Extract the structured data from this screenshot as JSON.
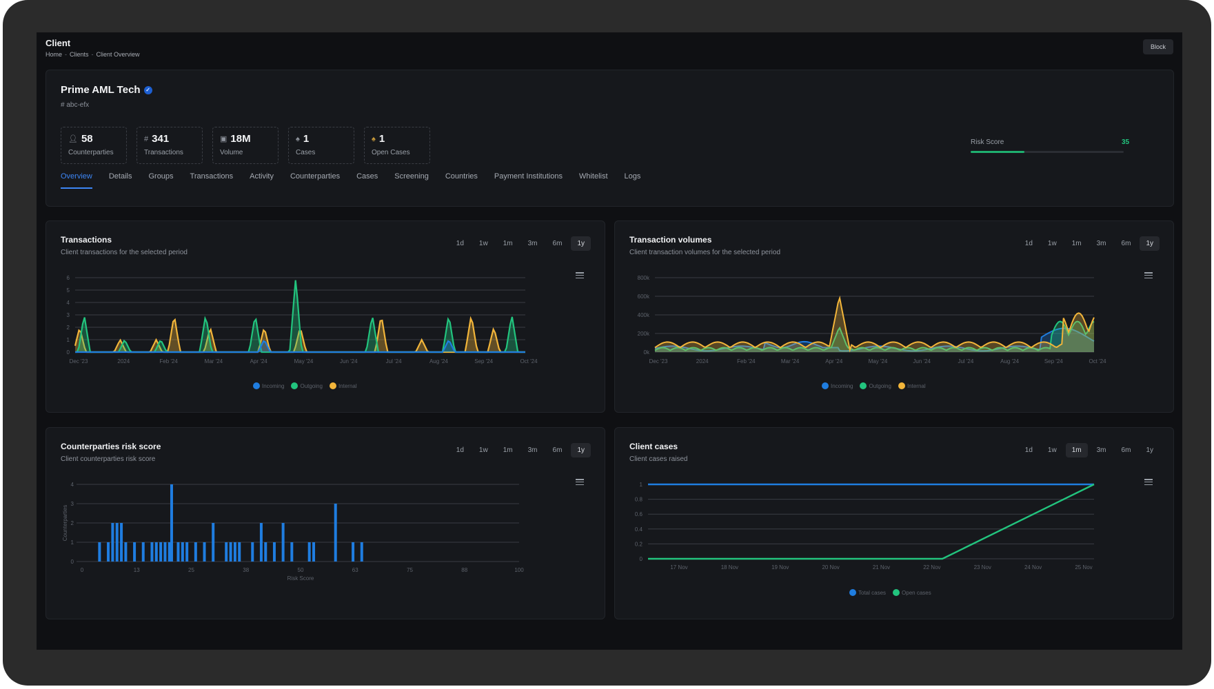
{
  "header": {
    "title": "Client",
    "breadcrumb": [
      "Home",
      "Clients",
      "Client Overview"
    ],
    "block_label": "Block"
  },
  "client": {
    "name": "Prime AML Tech",
    "id": "# abc-efx"
  },
  "stats": [
    {
      "icon": "user-icon",
      "value": "58",
      "label": "Counterparties"
    },
    {
      "icon": "hash-icon",
      "value": "341",
      "label": "Transactions"
    },
    {
      "icon": "money-icon",
      "value": "18M",
      "label": "Volume"
    },
    {
      "icon": "flame-icon",
      "value": "1",
      "label": "Cases"
    },
    {
      "icon": "flame-icon",
      "value": "1",
      "label": "Open Cases"
    }
  ],
  "risk": {
    "label": "Risk Score",
    "value": "35",
    "fraction": 0.35
  },
  "tabs": [
    "Overview",
    "Details",
    "Groups",
    "Transactions",
    "Activity",
    "Counterparties",
    "Cases",
    "Screening",
    "Countries",
    "Payment Institutions",
    "Whitelist",
    "Logs"
  ],
  "ranges": [
    "1d",
    "1w",
    "1m",
    "3m",
    "6m",
    "1y"
  ],
  "colors": {
    "incoming": "#1f7de0",
    "outgoing": "#22c47e",
    "internal": "#f2b53a",
    "accent": "#3d86f5"
  },
  "chart_data": [
    {
      "type": "area",
      "title": "Transactions",
      "subtitle": "Client transactions for the selected period",
      "active_range": "1y",
      "x": [
        "Dec '23",
        "2024",
        "Feb '24",
        "Mar '24",
        "Apr '24",
        "May '24",
        "Jun '24",
        "Jul '24",
        "Aug '24",
        "Sep '24",
        "Oct '24"
      ],
      "ylim": [
        0,
        6
      ],
      "yticks": [
        "0",
        "1",
        "2",
        "3",
        "4",
        "5",
        "6"
      ],
      "series": [
        {
          "name": "Incoming",
          "peaks": [
            {
              "x": 0.42,
              "y": 1
            },
            {
              "x": 0.83,
              "y": 1
            }
          ]
        },
        {
          "name": "Outgoing",
          "peaks": [
            {
              "x": 0.02,
              "y": 3
            },
            {
              "x": 0.11,
              "y": 1
            },
            {
              "x": 0.19,
              "y": 1
            },
            {
              "x": 0.29,
              "y": 3
            },
            {
              "x": 0.4,
              "y": 3
            },
            {
              "x": 0.49,
              "y": 6
            },
            {
              "x": 0.66,
              "y": 3
            },
            {
              "x": 0.83,
              "y": 3
            },
            {
              "x": 0.97,
              "y": 3
            }
          ]
        },
        {
          "name": "Internal",
          "peaks": [
            {
              "x": 0.01,
              "y": 2
            },
            {
              "x": 0.1,
              "y": 1
            },
            {
              "x": 0.18,
              "y": 1
            },
            {
              "x": 0.22,
              "y": 3
            },
            {
              "x": 0.3,
              "y": 2
            },
            {
              "x": 0.42,
              "y": 2
            },
            {
              "x": 0.5,
              "y": 2
            },
            {
              "x": 0.68,
              "y": 3
            },
            {
              "x": 0.77,
              "y": 1
            },
            {
              "x": 0.88,
              "y": 3
            },
            {
              "x": 0.93,
              "y": 2
            }
          ]
        }
      ],
      "legend": [
        "Incoming",
        "Outgoing",
        "Internal"
      ]
    },
    {
      "type": "area",
      "title": "Transaction volumes",
      "subtitle": "Client transaction volumes for the selected period",
      "active_range": "1y",
      "x": [
        "Dec '23",
        "2024",
        "Feb '24",
        "Mar '24",
        "Apr '24",
        "May '24",
        "Jun '24",
        "Jul '24",
        "Aug '24",
        "Sep '24",
        "Oct '24"
      ],
      "ylim": [
        0,
        800000
      ],
      "yticks": [
        "0k",
        "200k",
        "400k",
        "600k",
        "800k"
      ],
      "legend": [
        "Incoming",
        "Outgoing",
        "Internal"
      ]
    },
    {
      "type": "bar",
      "title": "Counterparties risk score",
      "subtitle": "Client counterparties risk score",
      "active_range": "1y",
      "xlabel": "Risk Score",
      "ylabel": "Counterparties",
      "xticks": [
        "0",
        "13",
        "25",
        "38",
        "50",
        "63",
        "75",
        "88",
        "100"
      ],
      "yticks": [
        "0",
        "1",
        "2",
        "3",
        "4"
      ],
      "ylim": [
        0,
        4
      ],
      "xlim": [
        0,
        100
      ],
      "points": [
        [
          4,
          1
        ],
        [
          6,
          1
        ],
        [
          7,
          2
        ],
        [
          8,
          2
        ],
        [
          9,
          2
        ],
        [
          10,
          1
        ],
        [
          12,
          1
        ],
        [
          14,
          1
        ],
        [
          16,
          1
        ],
        [
          17,
          1
        ],
        [
          18,
          1
        ],
        [
          19,
          1
        ],
        [
          20,
          1
        ],
        [
          20.5,
          4
        ],
        [
          22,
          1
        ],
        [
          23,
          1
        ],
        [
          24,
          1
        ],
        [
          26,
          1
        ],
        [
          28,
          1
        ],
        [
          30,
          2
        ],
        [
          33,
          1
        ],
        [
          34,
          1
        ],
        [
          35,
          1
        ],
        [
          36,
          1
        ],
        [
          39,
          1
        ],
        [
          41,
          2
        ],
        [
          42,
          1
        ],
        [
          44,
          1
        ],
        [
          46,
          2
        ],
        [
          48,
          1
        ],
        [
          52,
          1
        ],
        [
          53,
          1
        ],
        [
          58,
          3
        ],
        [
          62,
          1
        ],
        [
          64,
          1
        ]
      ]
    },
    {
      "type": "line",
      "title": "Client cases",
      "subtitle": "Client cases raised",
      "active_range": "1m",
      "x": [
        "17 Nov",
        "18 Nov",
        "19 Nov",
        "20 Nov",
        "21 Nov",
        "22 Nov",
        "23 Nov",
        "24 Nov",
        "25 Nov"
      ],
      "ylim": [
        0,
        1
      ],
      "yticks": [
        "0",
        "0.2",
        "0.4",
        "0.6",
        "0.8",
        "1"
      ],
      "series": [
        {
          "name": "Total cases",
          "points": [
            [
              0,
              1
            ],
            [
              1,
              1
            ]
          ]
        },
        {
          "name": "Open cases",
          "points": [
            [
              0,
              0
            ],
            [
              0.66,
              0
            ],
            [
              1,
              1
            ]
          ]
        }
      ],
      "legend": [
        "Total cases",
        "Open cases"
      ]
    }
  ]
}
